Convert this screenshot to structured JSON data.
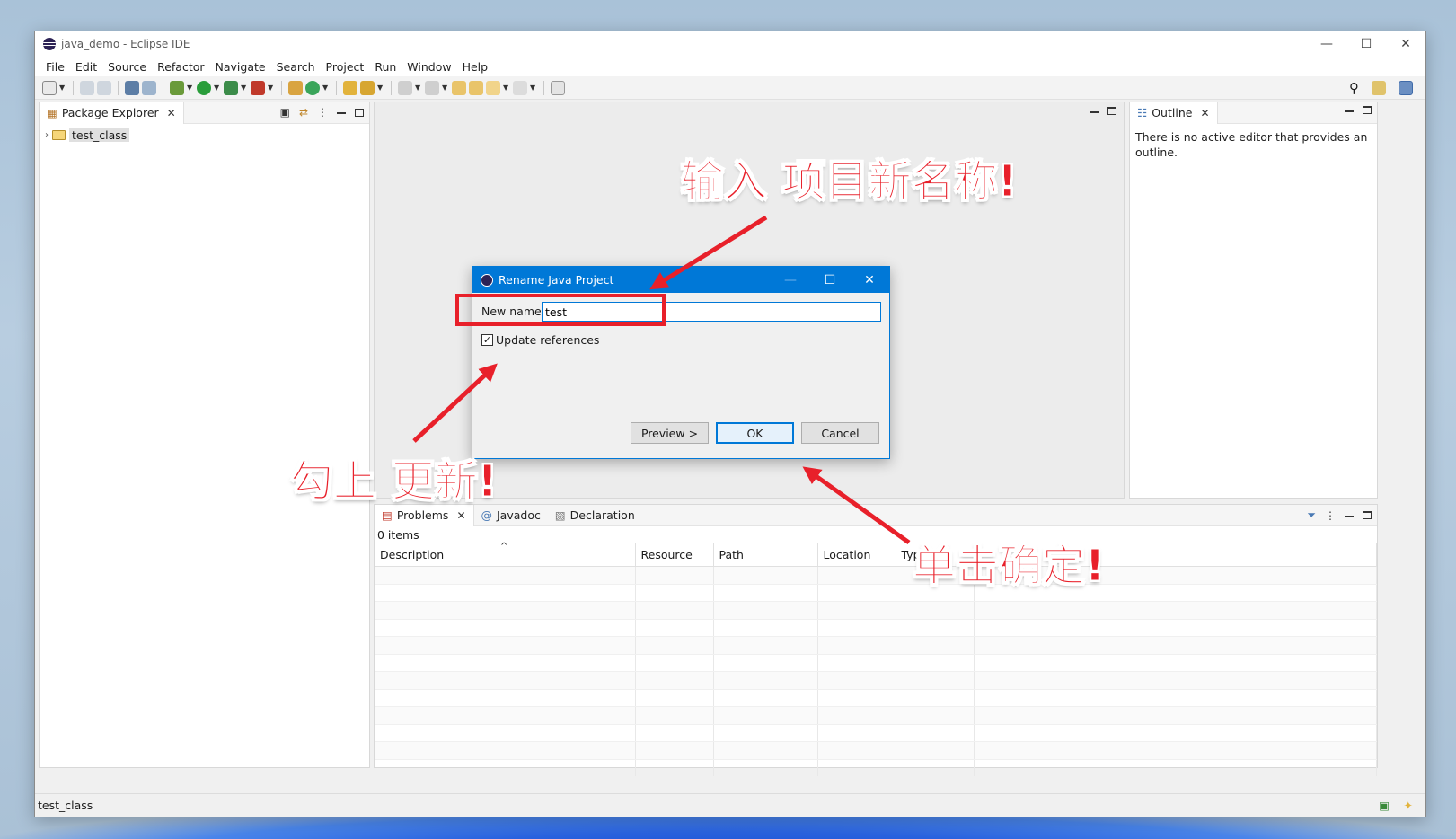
{
  "window": {
    "title": "java_demo - Eclipse IDE",
    "controls": [
      "—",
      "☐",
      "✕"
    ]
  },
  "menu": [
    "File",
    "Edit",
    "Source",
    "Refactor",
    "Navigate",
    "Search",
    "Project",
    "Run",
    "Window",
    "Help"
  ],
  "package_explorer": {
    "tab_label": "Package Explorer",
    "tree": [
      {
        "label": "test_class",
        "expanded": false
      }
    ]
  },
  "outline": {
    "tab_label": "Outline",
    "message": "There is no active editor that provides an outline."
  },
  "problems": {
    "tabs": [
      "Problems",
      "Javadoc",
      "Declaration"
    ],
    "count": "0 items",
    "columns": [
      "Description",
      "Resource",
      "Path",
      "Location",
      "Type"
    ],
    "sort_indicator": "^"
  },
  "status_bar": {
    "text": "test_class"
  },
  "dialog": {
    "title": "Rename Java Project",
    "new_name_label": "New name:",
    "new_name_value": "test",
    "update_references_label": "Update references",
    "update_references_checked": true,
    "buttons": {
      "preview": "Preview >",
      "ok": "OK",
      "cancel": "Cancel"
    }
  },
  "annotations": {
    "enter_name": "输入 项目新名称!",
    "check_update": "勾上 更新!",
    "click_ok": "单击确定!",
    "color": "#e8202a"
  }
}
